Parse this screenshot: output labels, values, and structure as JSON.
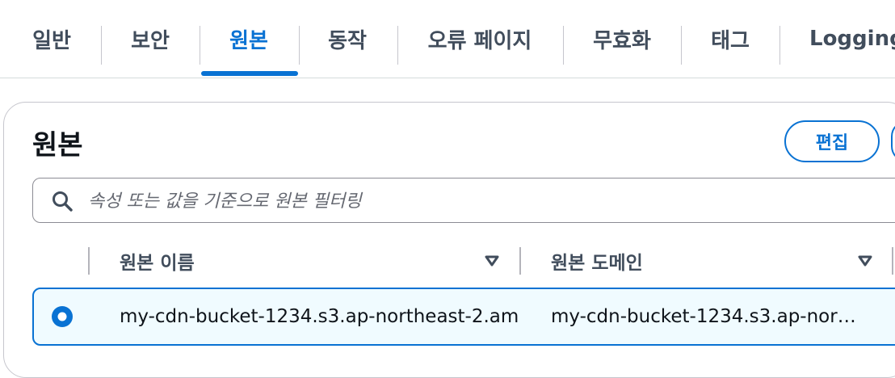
{
  "tabs": [
    {
      "label": "일반",
      "active": false
    },
    {
      "label": "보안",
      "active": false
    },
    {
      "label": "원본",
      "active": true
    },
    {
      "label": "동작",
      "active": false
    },
    {
      "label": "오류 페이지",
      "active": false
    },
    {
      "label": "무효화",
      "active": false
    },
    {
      "label": "태그",
      "active": false
    },
    {
      "label": "Logging",
      "active": false
    }
  ],
  "section": {
    "title": "원본",
    "edit_label": "편집"
  },
  "search": {
    "placeholder": "속성 또는 값을 기준으로 원본 필터링",
    "value": ""
  },
  "table": {
    "columns": [
      "원본 이름",
      "원본 도메인"
    ],
    "rows": [
      {
        "selected": true,
        "name": "my-cdn-bucket-1234.s3.ap-northeast-2.am",
        "domain": "my-cdn-bucket-1234.s3.ap-nor…"
      }
    ]
  },
  "icons": {
    "search": "search-icon",
    "sort": "caret-down-icon",
    "radio": "radio-selected-icon"
  },
  "colors": {
    "accent": "#0972d3",
    "text": "#0f141a",
    "muted": "#414d5c",
    "selected_row_bg": "#f0fbff"
  }
}
